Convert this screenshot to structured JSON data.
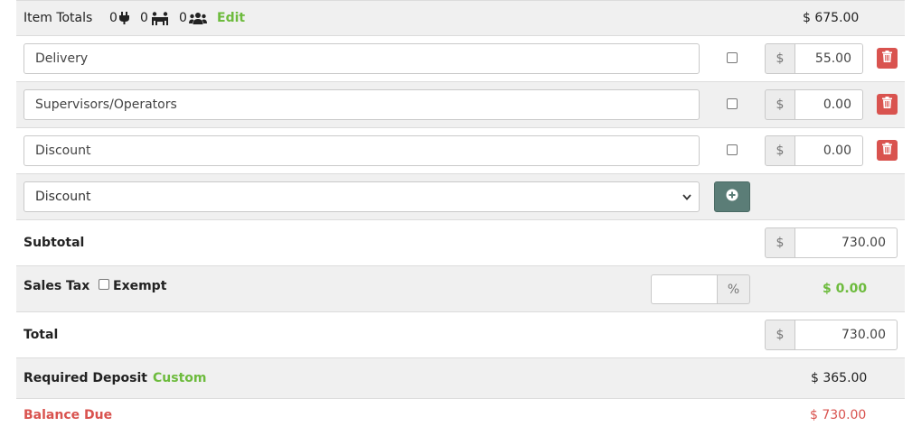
{
  "item_totals": {
    "label": "Item Totals",
    "count_outlets": "0",
    "count_workers": "0",
    "count_people": "0",
    "edit_label": "Edit",
    "amount": "$ 675.00"
  },
  "line_items": [
    {
      "name": "Delivery",
      "currency": "$",
      "amount": "55.00"
    },
    {
      "name": "Supervisors/Operators",
      "currency": "$",
      "amount": "0.00"
    },
    {
      "name": "Discount",
      "currency": "$",
      "amount": "0.00"
    }
  ],
  "add_item": {
    "selected": "Discount"
  },
  "subtotal": {
    "label": "Subtotal",
    "currency": "$",
    "amount": "730.00"
  },
  "sales_tax": {
    "label": "Sales Tax",
    "exempt_label": "Exempt",
    "percent_symbol": "%",
    "amount": "$ 0.00"
  },
  "total": {
    "label": "Total",
    "currency": "$",
    "amount": "730.00"
  },
  "deposit": {
    "label": "Required Deposit",
    "custom_label": "Custom",
    "amount": "$ 365.00"
  },
  "balance": {
    "label": "Balance Due",
    "amount": "$ 730.00"
  },
  "colors": {
    "green": "#6dbb3d",
    "red": "#d9534f",
    "row_gray": "#f0f0f0",
    "add_button": "#5b7d77"
  },
  "icons": {
    "outlet": "plug-icon",
    "worker": "people-carry-icon",
    "people": "users-icon",
    "delete": "trash-icon",
    "add": "plus-circle-icon"
  }
}
